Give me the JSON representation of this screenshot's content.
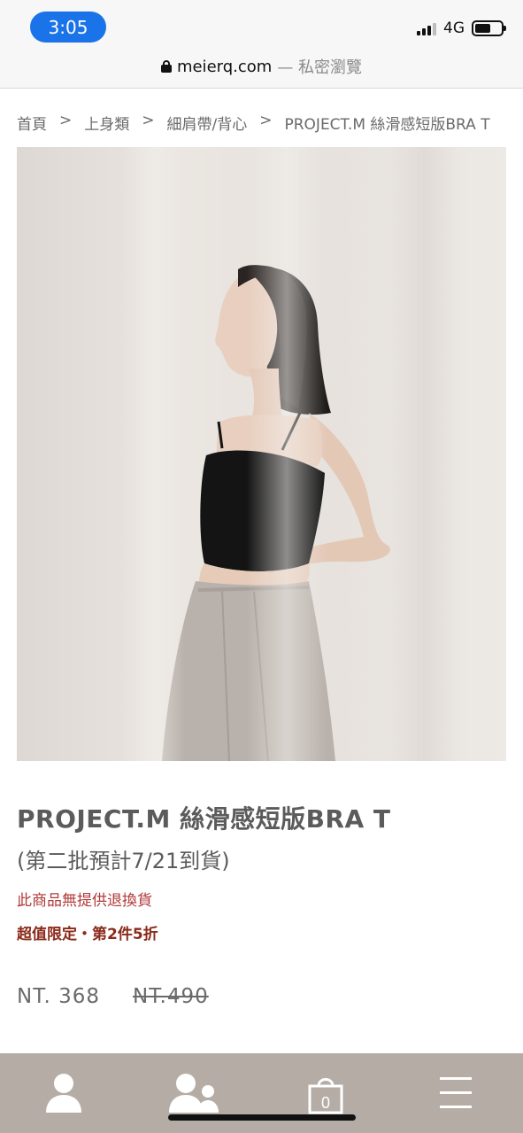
{
  "status_bar": {
    "time": "3:05",
    "network": "4G",
    "battery_level": 0.6,
    "signal_bars": 3
  },
  "browser": {
    "domain": "meierq.com",
    "mode": "— 私密瀏覽"
  },
  "breadcrumb": [
    {
      "label": "首頁"
    },
    {
      "label": "上身類"
    },
    {
      "label": "細肩帶/背心"
    },
    {
      "label": "PROJECT.M 絲滑感短版BRA T"
    }
  ],
  "breadcrumb_separator": ">",
  "product": {
    "title": "PROJECT.M 絲滑感短版BRA T",
    "subtitle": "(第二批預計7/21到貨)",
    "notice": "此商品無提供退換貨",
    "promo": "超值限定・第2件5折",
    "price": "NT. 368",
    "original_price": "NT.490"
  },
  "bottom_nav": {
    "cart_count": "0",
    "icons": [
      "account-icon",
      "members-icon",
      "cart-icon",
      "menu-icon"
    ]
  },
  "colors": {
    "accent": "#1a73e8",
    "notice": "#b23a3a",
    "promo": "#8b2a1a",
    "nav_bg": "#b5ada5"
  }
}
